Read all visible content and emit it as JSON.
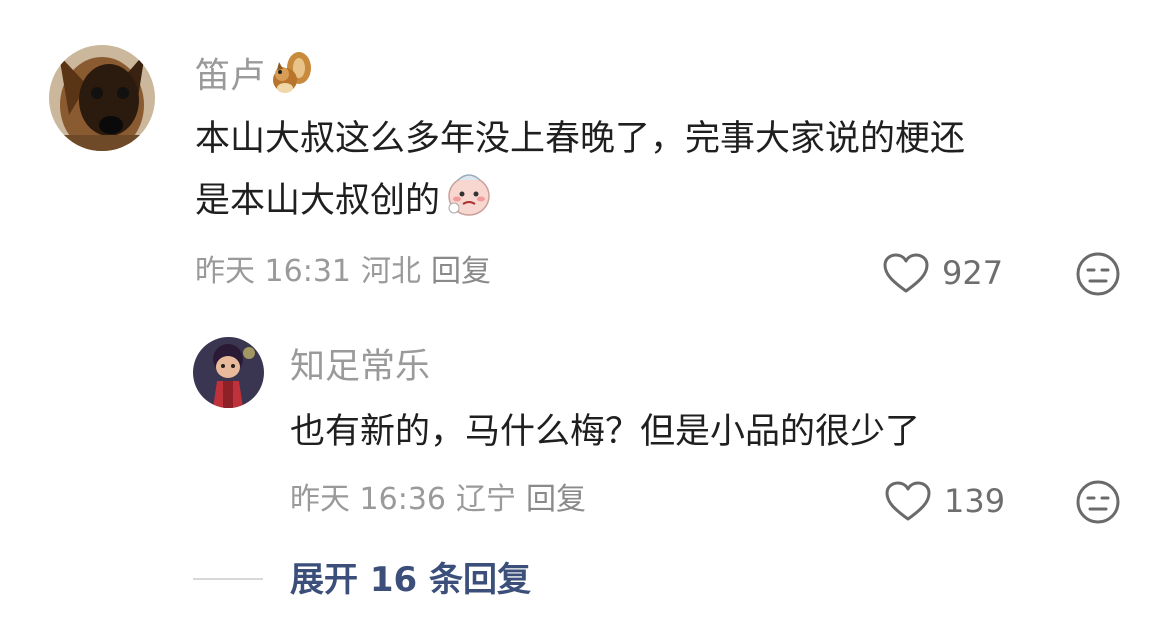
{
  "comments": [
    {
      "username": "笛卢",
      "username_emoji": "chipmunk-icon",
      "text_lines": [
        "本山大叔这么多年没上春晚了，完事大家说的梗还",
        "是本山大叔创的"
      ],
      "text_emoji": "sad-face-icon",
      "time": "昨天 16:31",
      "location": "河北",
      "reply_label": "回复",
      "likes": "927"
    },
    {
      "username": "知足常乐",
      "text_lines": [
        "也有新的，马什么梅？但是小品的很少了"
      ],
      "time": "昨天 16:36",
      "location": "辽宁",
      "reply_label": "回复",
      "likes": "139"
    }
  ],
  "expand_replies": "展开 16 条回复",
  "colors": {
    "username": "#9a9a9a",
    "text": "#1f1f1f",
    "meta": "#9a9a9a",
    "expand": "#3b4f7a"
  }
}
